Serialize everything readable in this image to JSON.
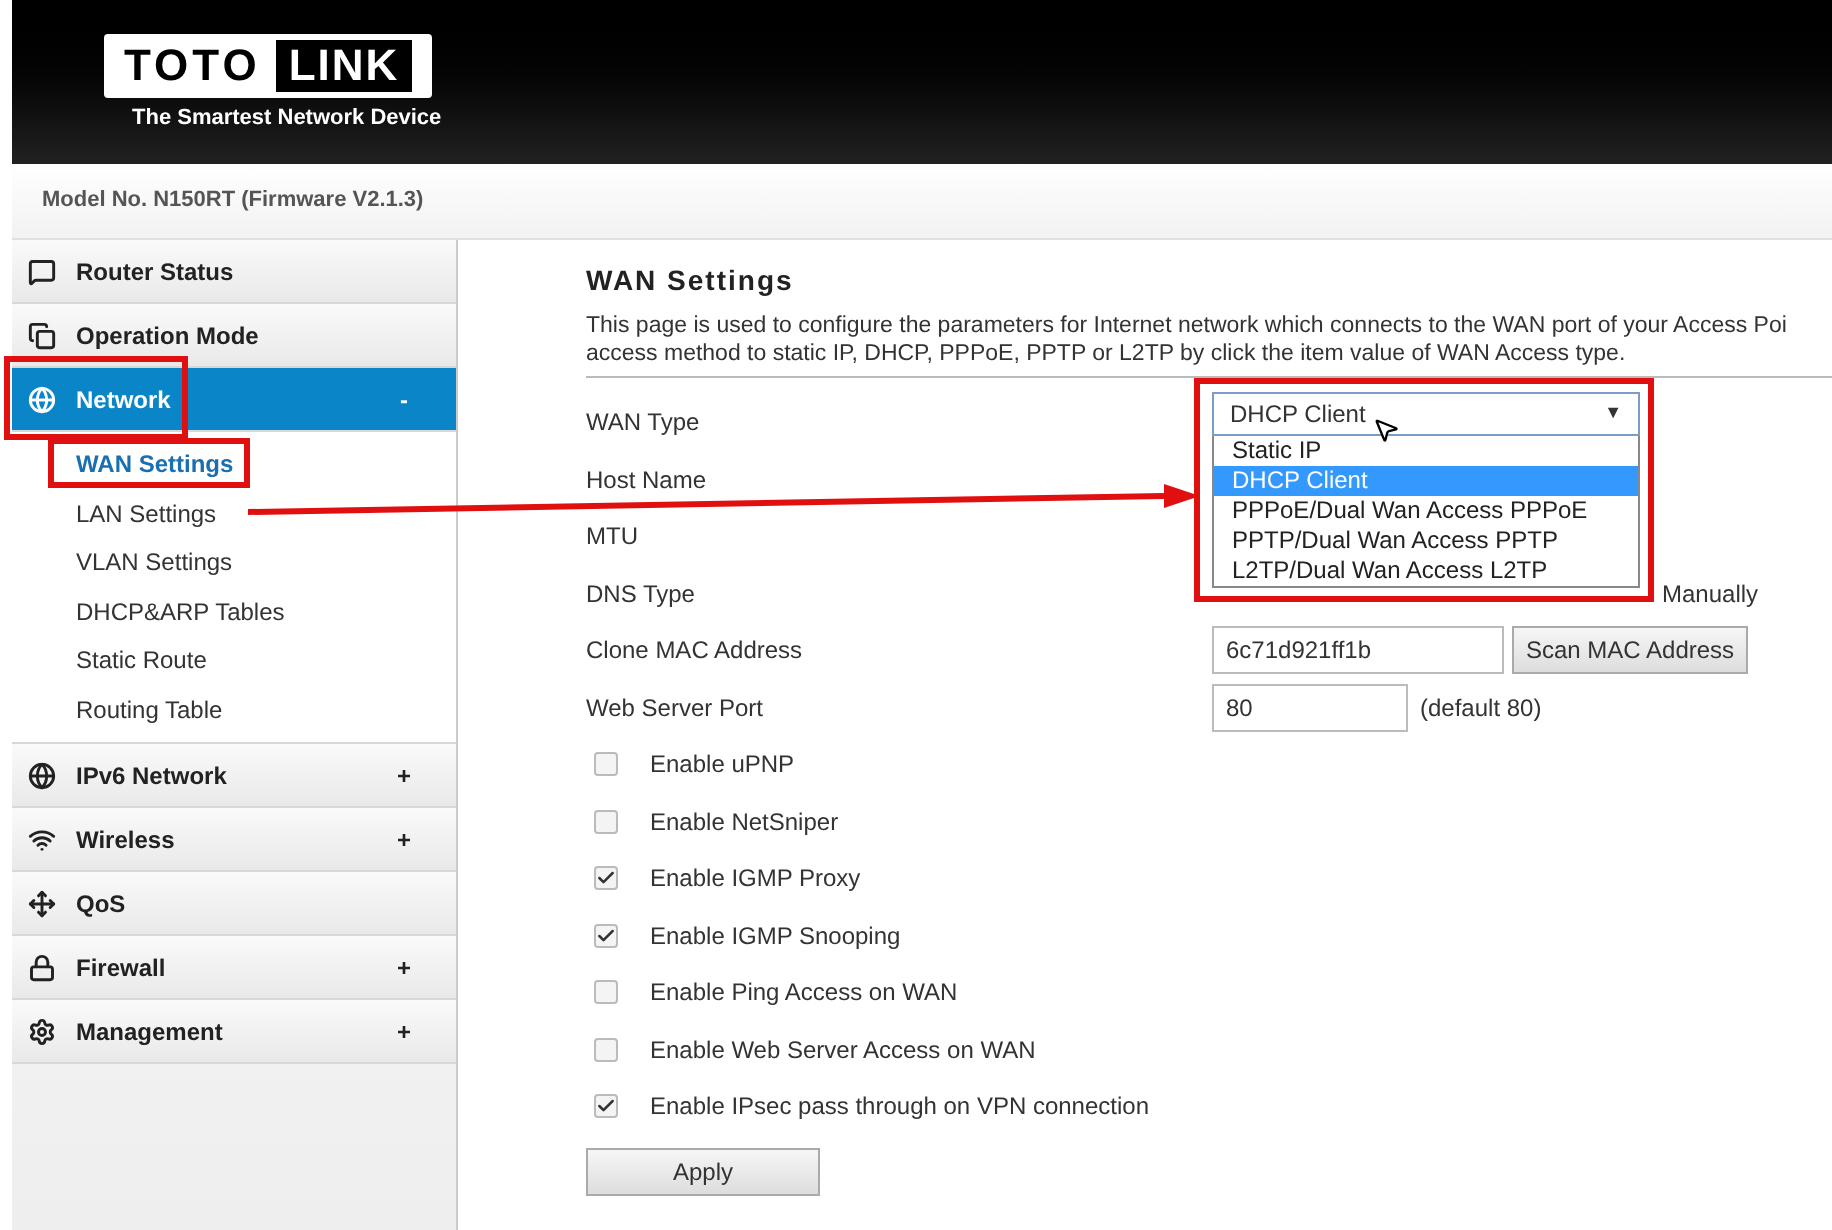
{
  "header": {
    "logo_left": "TOTO",
    "logo_right": "LINK",
    "tagline": "The Smartest Network Device"
  },
  "model": "Model No. N150RT (Firmware V2.1.3)",
  "sidebar": {
    "items": [
      {
        "label": "Router Status",
        "selected": false
      },
      {
        "label": "Operation Mode",
        "selected": false
      },
      {
        "label": "Network",
        "selected": true,
        "toggle": "-",
        "expanded": true,
        "children": [
          {
            "label": "WAN Settings",
            "selected": true
          },
          {
            "label": "LAN Settings",
            "selected": false
          },
          {
            "label": "VLAN Settings",
            "selected": false
          },
          {
            "label": "DHCP&ARP Tables",
            "selected": false
          },
          {
            "label": "Static Route",
            "selected": false
          },
          {
            "label": "Routing Table",
            "selected": false
          }
        ]
      },
      {
        "label": "IPv6 Network",
        "selected": false,
        "toggle": "+"
      },
      {
        "label": "Wireless",
        "selected": false,
        "toggle": "+"
      },
      {
        "label": "QoS",
        "selected": false
      },
      {
        "label": "Firewall",
        "selected": false,
        "toggle": "+"
      },
      {
        "label": "Management",
        "selected": false,
        "toggle": "+"
      }
    ]
  },
  "page": {
    "title": "WAN Settings",
    "description_lines": [
      "This page is used to configure the parameters for Internet network which connects to the WAN port of your Access Poi",
      "access method to static IP, DHCP, PPPoE, PPTP or L2TP by click the item value of WAN Access type."
    ],
    "wan_type": {
      "label": "WAN Type",
      "value": "DHCP Client",
      "arrow": "▼",
      "expanded": true,
      "options": [
        {
          "label": "Static IP",
          "selected": false
        },
        {
          "label": "DHCP Client",
          "selected": true
        },
        {
          "label": "PPPoE/Dual Wan Access PPPoE",
          "selected": false
        },
        {
          "label": "PPTP/Dual Wan Access PPTP",
          "selected": false
        },
        {
          "label": "L2TP/Dual Wan Access L2TP",
          "selected": false
        }
      ]
    },
    "host_name": {
      "label": "Host Name"
    },
    "mtu": {
      "label": "MTU"
    },
    "dns_type": {
      "label": "DNS Type",
      "option_partial": "Manually"
    },
    "clone_mac": {
      "label": "Clone MAC Address",
      "value": "6c71d921ff1b",
      "button": "Scan MAC Address"
    },
    "web_port": {
      "label": "Web Server Port",
      "value": "80",
      "hint": "(default 80)"
    },
    "checkboxes": [
      {
        "label": "Enable uPNP",
        "checked": false
      },
      {
        "label": "Enable NetSniper",
        "checked": false
      },
      {
        "label": "Enable IGMP Proxy",
        "checked": true
      },
      {
        "label": "Enable IGMP Snooping",
        "checked": true
      },
      {
        "label": "Enable Ping Access on WAN",
        "checked": false
      },
      {
        "label": "Enable Web Server Access on WAN",
        "checked": false
      },
      {
        "label": "Enable IPsec pass through on VPN connection",
        "checked": true
      }
    ],
    "apply": "Apply"
  }
}
